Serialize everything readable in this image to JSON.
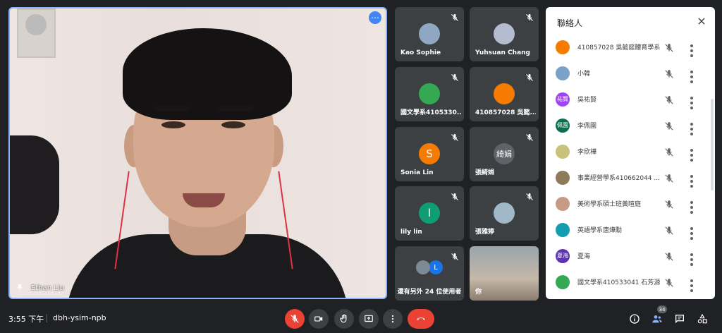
{
  "main_speaker": {
    "name": "Ethan Liu"
  },
  "tiles": [
    {
      "name": "Kao Sophie",
      "avatar_text": "",
      "avatar_color": "#8fa7c2"
    },
    {
      "name": "Yuhsuan Chang",
      "avatar_text": "",
      "avatar_color": "#b4bcd0"
    },
    {
      "name": "國文學系4105330...",
      "avatar_text": "",
      "avatar_color": "#34a853"
    },
    {
      "name": "410857028 吳懿...",
      "avatar_text": "",
      "avatar_color": "#f57c00"
    },
    {
      "name": "Sonia Lin",
      "avatar_text": "S",
      "avatar_color": "#f57c00"
    },
    {
      "name": "張綺娟",
      "avatar_text": "綺娟",
      "avatar_color": "#5f6368"
    },
    {
      "name": "lily lin",
      "avatar_text": "l",
      "avatar_color": "#0f9d76"
    },
    {
      "name": "張雅婷",
      "avatar_text": "",
      "avatar_color": "#a0b8c8"
    },
    {
      "name": "還有另外 24 位使用者",
      "avatar_text": "L",
      "avatar_color": "#1a73e8"
    },
    {
      "name": "你",
      "avatar_text": "",
      "avatar_color": "#6b6f72"
    }
  ],
  "panel": {
    "title": "聯絡人",
    "participants": [
      {
        "name": "410857028 吳懿庭體育學系",
        "avatar_text": "",
        "avatar_color": "#f57c00"
      },
      {
        "name": "小韓",
        "avatar_text": "",
        "avatar_color": "#7aa2c8"
      },
      {
        "name": "吳祐賢",
        "avatar_text": "祐賢",
        "avatar_color": "#a142f4"
      },
      {
        "name": "李佩園",
        "avatar_text": "佩園",
        "avatar_color": "#0b6e4f"
      },
      {
        "name": "李欣樺",
        "avatar_text": "",
        "avatar_color": "#c9c27a"
      },
      {
        "name": "事業經營學系410662044 ...",
        "avatar_text": "",
        "avatar_color": "#8d7b5c"
      },
      {
        "name": "美術學系碩士班黃暄庭",
        "avatar_text": "",
        "avatar_color": "#c49b86"
      },
      {
        "name": "英語學系唐燁勳",
        "avatar_text": "",
        "avatar_color": "#129eaf"
      },
      {
        "name": "夏海",
        "avatar_text": "夏海",
        "avatar_color": "#5e35b1"
      },
      {
        "name": "國文學系410533041 石芳源",
        "avatar_text": "",
        "avatar_color": "#34a853"
      }
    ]
  },
  "bottom_bar": {
    "time": "3:55 下午",
    "meeting_code": "dbh-ysim-npb",
    "participant_count": "34"
  }
}
